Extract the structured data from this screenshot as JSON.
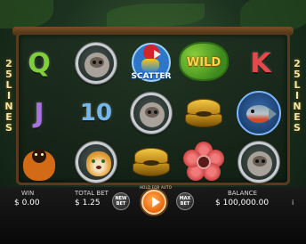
{
  "lines_indicator": {
    "left": [
      "2",
      "5",
      "L",
      "I",
      "N",
      "E",
      "S"
    ],
    "right": [
      "2",
      "5",
      "L",
      "I",
      "N",
      "E",
      "S"
    ]
  },
  "reels": {
    "symbols": [
      [
        "Q",
        "sloth",
        "parrot-scatter",
        "wild",
        "K"
      ],
      [
        "J",
        "10",
        "sloth",
        "clam",
        "piranha"
      ],
      [
        "monkey",
        "jaguar",
        "clam",
        "rafflesia",
        "sloth"
      ]
    ],
    "letter_colors": {
      "Q": "#7fcf3a",
      "K": "#e8484a",
      "J": "#a872e0",
      "10": "#74b7e8"
    },
    "scatter_label": "SCATTER",
    "wild_label": "WILD"
  },
  "bottom_bar": {
    "win_label": "WIN",
    "win_value": "$ 0.00",
    "total_bet_label": "TOTAL BET",
    "total_bet_value": "$ 1.25",
    "new_bet_label": "NEW BET",
    "spin_ring_text": "HOLD FOR AUTO",
    "max_bet_label": "MAX BET",
    "balance_label": "BALANCE",
    "balance_value": "$ 100,000.00",
    "info_label": "i"
  },
  "colors": {
    "frame": "#5a3a1c",
    "spin": "#e8650a",
    "lines_text": "#f1e6a8"
  }
}
